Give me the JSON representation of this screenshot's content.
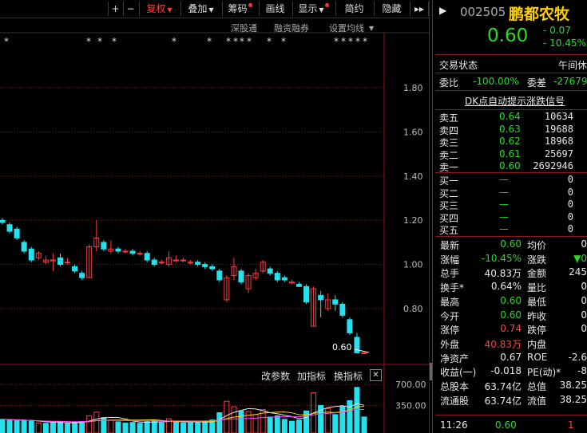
{
  "toolbar": {
    "plus": "+",
    "minus": "−",
    "fuquan": "复权",
    "diejia": "叠加",
    "chouma": "筹码",
    "huaxian": "画线",
    "xianshi": "显示",
    "jianyue": "简约",
    "yincang": "隐藏",
    "more": "▸▸"
  },
  "subbar": {
    "shengu": "深股通",
    "rongzi": "融资融券",
    "setting": "设置均线"
  },
  "price_axis": [
    "1.80",
    "1.60",
    "1.40",
    "1.20",
    "1.00",
    "0.80"
  ],
  "last_price_label": "0.60",
  "volume_header": {
    "gaicanshu": "改参数",
    "jiazhibiao": "加指标",
    "huanzhibiao": "换指标",
    "close": "✕"
  },
  "volume_axis": [
    "700.00",
    "350.00"
  ],
  "stock": {
    "code": "002505",
    "name": "鹏都农牧",
    "price": "0.60",
    "change": "- 0.07",
    "change_pct": "- 10.45%"
  },
  "status": {
    "label": "交易状态",
    "value": "午间休"
  },
  "weibi": {
    "label": "委比",
    "value": "-100.00%",
    "cha_label": "委差",
    "cha_value": "-27679"
  },
  "dk_link": "DK点自动提示涨跌信号",
  "sell": [
    {
      "label": "卖五",
      "price": "0.64",
      "vol": "10634"
    },
    {
      "label": "卖四",
      "price": "0.63",
      "vol": "19688"
    },
    {
      "label": "卖三",
      "price": "0.62",
      "vol": "18968"
    },
    {
      "label": "卖二",
      "price": "0.61",
      "vol": "25697"
    },
    {
      "label": "卖一",
      "price": "0.60",
      "vol": "2692946"
    }
  ],
  "buy": [
    {
      "label": "买一",
      "price": "—",
      "vol": "0"
    },
    {
      "label": "买二",
      "price": "—",
      "vol": "0"
    },
    {
      "label": "买三",
      "price": "—",
      "vol": "0"
    },
    {
      "label": "买四",
      "price": "—",
      "vol": "0"
    },
    {
      "label": "买五",
      "price": "—",
      "vol": "0"
    }
  ],
  "stats": [
    {
      "l1": "最新",
      "v1": "0.60",
      "c1": "g",
      "l2": "均价",
      "v2": "0"
    },
    {
      "l1": "涨幅",
      "v1": "-10.45%",
      "c1": "g",
      "l2": "涨跌",
      "v2": "▼0"
    },
    {
      "l1": "总手",
      "v1": "40.83万",
      "c1": "w",
      "l2": "金额",
      "v2": "245"
    },
    {
      "l1": "换手*",
      "v1": "0.64%",
      "c1": "w",
      "l2": "量比",
      "v2": "0"
    },
    {
      "l1": "最高",
      "v1": "0.60",
      "c1": "g",
      "l2": "最低",
      "v2": "0"
    },
    {
      "l1": "今开",
      "v1": "0.60",
      "c1": "g",
      "l2": "昨收",
      "v2": "0"
    },
    {
      "l1": "涨停",
      "v1": "0.74",
      "c1": "r",
      "l2": "跌停",
      "v2": "0"
    },
    {
      "l1": "外盘",
      "v1": "40.83万",
      "c1": "r",
      "l2": "内盘",
      "v2": ""
    },
    {
      "l1": "净资产",
      "v1": "0.67",
      "c1": "w",
      "l2": "ROE",
      "v2": "-2.6"
    },
    {
      "l1": "收益(一)",
      "v1": "-0.018",
      "c1": "w",
      "l2": "PE(动)*",
      "v2": "-8"
    },
    {
      "l1": "总股本",
      "v1": "63.74亿",
      "c1": "w",
      "l2": "总值",
      "v2": "38.25"
    },
    {
      "l1": "流通股",
      "v1": "63.74亿",
      "c1": "w",
      "l2": "流值",
      "v2": "38.25"
    }
  ],
  "tick": {
    "time": "11:26",
    "price": "0.60",
    "vol": "1"
  },
  "colors": {
    "up": "#ff3c3c",
    "down": "#26e0ee",
    "grid": "#8b1a1a"
  },
  "chart_data": {
    "type": "candlestick",
    "ylim": [
      0.54,
      1.93
    ],
    "candles": [
      {
        "o": 1.2,
        "c": 1.19,
        "h": 1.21,
        "l": 1.18
      },
      {
        "o": 1.18,
        "c": 1.15,
        "h": 1.19,
        "l": 1.14
      },
      {
        "o": 1.16,
        "c": 1.12,
        "h": 1.17,
        "l": 1.11
      },
      {
        "o": 1.1,
        "c": 1.06,
        "h": 1.11,
        "l": 1.05
      },
      {
        "o": 1.07,
        "c": 1.02,
        "h": 1.08,
        "l": 1.01
      },
      {
        "o": 1.03,
        "c": 1.05,
        "h": 1.06,
        "l": 1.02
      },
      {
        "o": 1.01,
        "c": 1.02,
        "h": 1.04,
        "l": 1.0
      },
      {
        "o": 1.02,
        "c": 1.02,
        "h": 1.05,
        "l": 0.97
      },
      {
        "o": 1.03,
        "c": 1.0,
        "h": 1.05,
        "l": 0.99
      },
      {
        "o": 1.01,
        "c": 1.01,
        "h": 1.03,
        "l": 1.0
      },
      {
        "o": 0.99,
        "c": 0.97,
        "h": 1.0,
        "l": 0.96
      },
      {
        "o": 0.96,
        "c": 0.94,
        "h": 0.97,
        "l": 0.93
      },
      {
        "o": 0.94,
        "c": 1.08,
        "h": 1.09,
        "l": 0.94
      },
      {
        "o": 1.08,
        "c": 1.12,
        "h": 1.2,
        "l": 1.06
      },
      {
        "o": 1.1,
        "c": 1.07,
        "h": 1.11,
        "l": 1.06
      },
      {
        "o": 1.06,
        "c": 1.07,
        "h": 1.11,
        "l": 1.05
      },
      {
        "o": 1.07,
        "c": 1.06,
        "h": 1.08,
        "l": 1.05
      },
      {
        "o": 1.06,
        "c": 1.06,
        "h": 1.07,
        "l": 1.05
      },
      {
        "o": 1.06,
        "c": 1.05,
        "h": 1.07,
        "l": 1.04
      },
      {
        "o": 1.05,
        "c": 1.05,
        "h": 1.06,
        "l": 1.04
      },
      {
        "o": 1.05,
        "c": 1.02,
        "h": 1.06,
        "l": 1.01
      },
      {
        "o": 1.02,
        "c": 1.0,
        "h": 1.03,
        "l": 0.99
      },
      {
        "o": 1.01,
        "c": 1.01,
        "h": 1.02,
        "l": 1.0
      },
      {
        "o": 1.0,
        "c": 1.03,
        "h": 1.06,
        "l": 0.99
      },
      {
        "o": 1.02,
        "c": 1.02,
        "h": 1.04,
        "l": 1.01
      },
      {
        "o": 1.02,
        "c": 1.02,
        "h": 1.03,
        "l": 1.01
      },
      {
        "o": 1.01,
        "c": 1.01,
        "h": 1.02,
        "l": 1.0
      },
      {
        "o": 1.01,
        "c": 1.0,
        "h": 1.02,
        "l": 0.99
      },
      {
        "o": 1.0,
        "c": 0.99,
        "h": 1.01,
        "l": 0.98
      },
      {
        "o": 0.99,
        "c": 0.98,
        "h": 1.0,
        "l": 0.97
      },
      {
        "o": 0.97,
        "c": 0.93,
        "h": 0.98,
        "l": 0.92
      },
      {
        "o": 0.84,
        "c": 0.94,
        "h": 0.95,
        "l": 0.83
      },
      {
        "o": 0.95,
        "c": 0.99,
        "h": 1.03,
        "l": 0.93
      },
      {
        "o": 0.97,
        "c": 0.92,
        "h": 0.98,
        "l": 0.91
      },
      {
        "o": 0.89,
        "c": 0.95,
        "h": 0.96,
        "l": 0.87
      },
      {
        "o": 0.94,
        "c": 0.96,
        "h": 0.98,
        "l": 0.93
      },
      {
        "o": 0.97,
        "c": 1.01,
        "h": 1.02,
        "l": 0.96
      },
      {
        "o": 0.98,
        "c": 0.96,
        "h": 0.99,
        "l": 0.95
      },
      {
        "o": 0.96,
        "c": 0.93,
        "h": 0.97,
        "l": 0.92
      },
      {
        "o": 0.94,
        "c": 0.93,
        "h": 0.95,
        "l": 0.92
      },
      {
        "o": 0.92,
        "c": 0.92,
        "h": 0.93,
        "l": 0.91
      },
      {
        "o": 0.91,
        "c": 0.9,
        "h": 0.92,
        "l": 0.9
      },
      {
        "o": 0.9,
        "c": 0.83,
        "h": 0.91,
        "l": 0.82
      },
      {
        "o": 0.72,
        "c": 0.89,
        "h": 0.9,
        "l": 0.72
      },
      {
        "o": 0.86,
        "c": 0.84,
        "h": 0.88,
        "l": 0.76
      },
      {
        "o": 0.8,
        "c": 0.84,
        "h": 0.87,
        "l": 0.79
      },
      {
        "o": 0.84,
        "c": 0.82,
        "h": 0.86,
        "l": 0.79
      },
      {
        "o": 0.82,
        "c": 0.77,
        "h": 0.83,
        "l": 0.76
      },
      {
        "o": 0.75,
        "c": 0.69,
        "h": 0.76,
        "l": 0.68
      },
      {
        "o": 0.67,
        "c": 0.6,
        "h": 0.69,
        "l": 0.6
      },
      {
        "o": 0.6,
        "c": 0.6,
        "h": 0.6,
        "l": 0.6
      }
    ],
    "volume": [
      {
        "v": 120,
        "up": false
      },
      {
        "v": 110,
        "up": false
      },
      {
        "v": 105,
        "up": false
      },
      {
        "v": 95,
        "up": false
      },
      {
        "v": 90,
        "up": false
      },
      {
        "v": 60,
        "up": true
      },
      {
        "v": 55,
        "up": false
      },
      {
        "v": 65,
        "up": false
      },
      {
        "v": 80,
        "up": false
      },
      {
        "v": 50,
        "up": false
      },
      {
        "v": 70,
        "up": false
      },
      {
        "v": 85,
        "up": false
      },
      {
        "v": 180,
        "up": true
      },
      {
        "v": 240,
        "up": true
      },
      {
        "v": 150,
        "up": false
      },
      {
        "v": 110,
        "up": true
      },
      {
        "v": 80,
        "up": false
      },
      {
        "v": 60,
        "up": false
      },
      {
        "v": 70,
        "up": false
      },
      {
        "v": 55,
        "up": false
      },
      {
        "v": 90,
        "up": false
      },
      {
        "v": 100,
        "up": false
      },
      {
        "v": 60,
        "up": false
      },
      {
        "v": 130,
        "up": true
      },
      {
        "v": 80,
        "up": false
      },
      {
        "v": 60,
        "up": false
      },
      {
        "v": 65,
        "up": false
      },
      {
        "v": 70,
        "up": false
      },
      {
        "v": 90,
        "up": false
      },
      {
        "v": 110,
        "up": false
      },
      {
        "v": 230,
        "up": false
      },
      {
        "v": 420,
        "up": true
      },
      {
        "v": 330,
        "up": true
      },
      {
        "v": 260,
        "up": false
      },
      {
        "v": 250,
        "up": true
      },
      {
        "v": 200,
        "up": true
      },
      {
        "v": 280,
        "up": true
      },
      {
        "v": 160,
        "up": false
      },
      {
        "v": 180,
        "up": false
      },
      {
        "v": 120,
        "up": false
      },
      {
        "v": 90,
        "up": false
      },
      {
        "v": 110,
        "up": false
      },
      {
        "v": 260,
        "up": false
      },
      {
        "v": 560,
        "up": true
      },
      {
        "v": 350,
        "up": false
      },
      {
        "v": 300,
        "up": true
      },
      {
        "v": 200,
        "up": false
      },
      {
        "v": 330,
        "up": false
      },
      {
        "v": 430,
        "up": false
      },
      {
        "v": 650,
        "up": false
      },
      {
        "v": 160,
        "up": false
      }
    ],
    "vol_ylim": [
      0,
      760
    ]
  }
}
